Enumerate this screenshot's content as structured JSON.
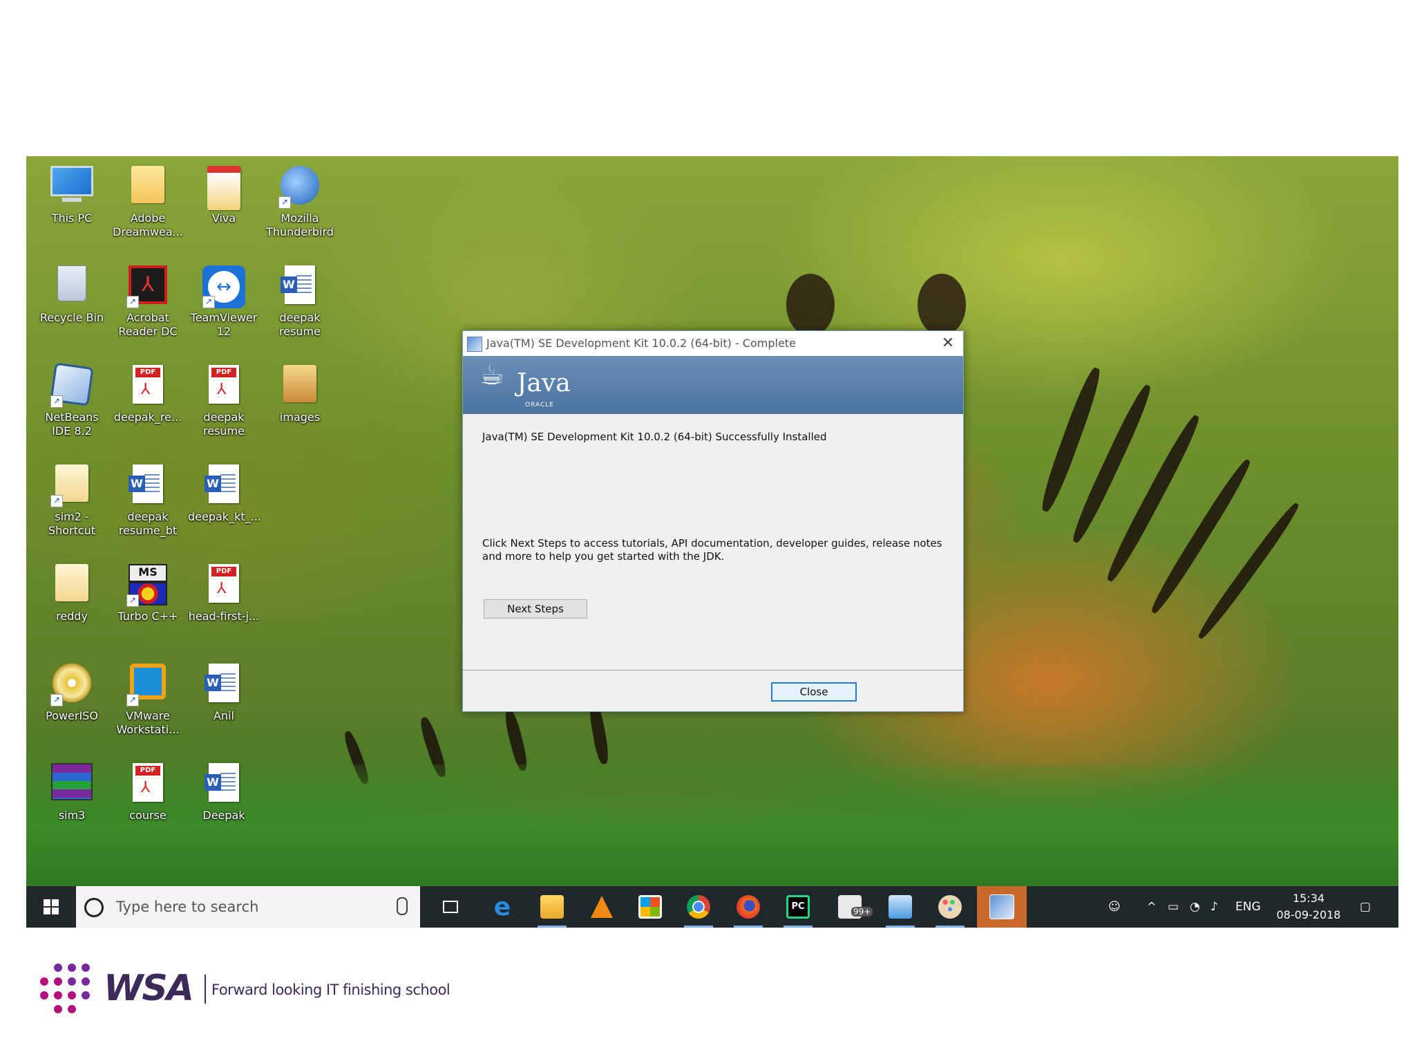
{
  "desktop": {
    "icons": [
      {
        "label": "This PC",
        "kind": "computer-icon"
      },
      {
        "label": "Adobe Dreamwea...",
        "kind": "folder-icon"
      },
      {
        "label": "Viva",
        "kind": "folder-doc-icon"
      },
      {
        "label": "Mozilla Thunderbird",
        "kind": "thunderbird-icon"
      },
      {
        "label": "Recycle Bin",
        "kind": "recycle-bin-icon"
      },
      {
        "label": "Acrobat Reader DC",
        "kind": "acrobat-icon"
      },
      {
        "label": "TeamViewer 12",
        "kind": "teamviewer-icon"
      },
      {
        "label": "deepak resume",
        "kind": "word-doc-icon"
      },
      {
        "label": "NetBeans IDE 8.2",
        "kind": "netbeans-icon"
      },
      {
        "label": "deepak_re...",
        "kind": "pdf-icon"
      },
      {
        "label": "deepak resume",
        "kind": "pdf-icon"
      },
      {
        "label": "images",
        "kind": "folder-icon"
      },
      {
        "label": "sim2 - Shortcut",
        "kind": "folder-icon"
      },
      {
        "label": "deepak resume_bt",
        "kind": "word-doc-icon"
      },
      {
        "label": "deepak_kt_...",
        "kind": "word-doc-icon"
      },
      {
        "label": "reddy",
        "kind": "folder-icon"
      },
      {
        "label": "Turbo C++",
        "kind": "turbo-cpp-icon"
      },
      {
        "label": "head-first-j...",
        "kind": "pdf-icon"
      },
      {
        "label": "PowerISO",
        "kind": "poweriso-icon"
      },
      {
        "label": "VMware Workstati...",
        "kind": "vmware-icon"
      },
      {
        "label": "Anil",
        "kind": "word-doc-icon"
      },
      {
        "label": "sim3",
        "kind": "winrar-icon"
      },
      {
        "label": "course",
        "kind": "pdf-icon"
      },
      {
        "label": "Deepak",
        "kind": "word-doc-icon"
      }
    ],
    "word_badge": "W",
    "pdf_badge": "PDF",
    "ms_badge": "MS"
  },
  "dialog": {
    "title": "Java(TM) SE Development Kit 10.0.2 (64-bit) - Complete",
    "close_glyph": "✕",
    "brand": "Java",
    "brand_sub": "ORACLE",
    "installed_msg": "Java(TM) SE Development Kit 10.0.2 (64-bit) Successfully Installed",
    "info_line1": "Click Next Steps to access tutorials, API documentation, developer guides, release notes",
    "info_line2": "and more to help you get started with the JDK.",
    "next_steps_label": "Next Steps",
    "close_label": "Close"
  },
  "taskbar": {
    "search_placeholder": "Type here to search",
    "mail_badge": "99+",
    "pycharm_label": "PC",
    "language": "ENG",
    "time": "15:34",
    "date": "08-09-2018"
  },
  "footer": {
    "brand": "WSA",
    "tagline": "Forward looking IT finishing school"
  },
  "colors": {
    "taskbar": "#20282c",
    "dialog_banner": "#4b73a0",
    "accent_blue": "#2a7ad7",
    "brand_purple": "#3c2a5a",
    "brand_magenta": "#b0127a"
  }
}
